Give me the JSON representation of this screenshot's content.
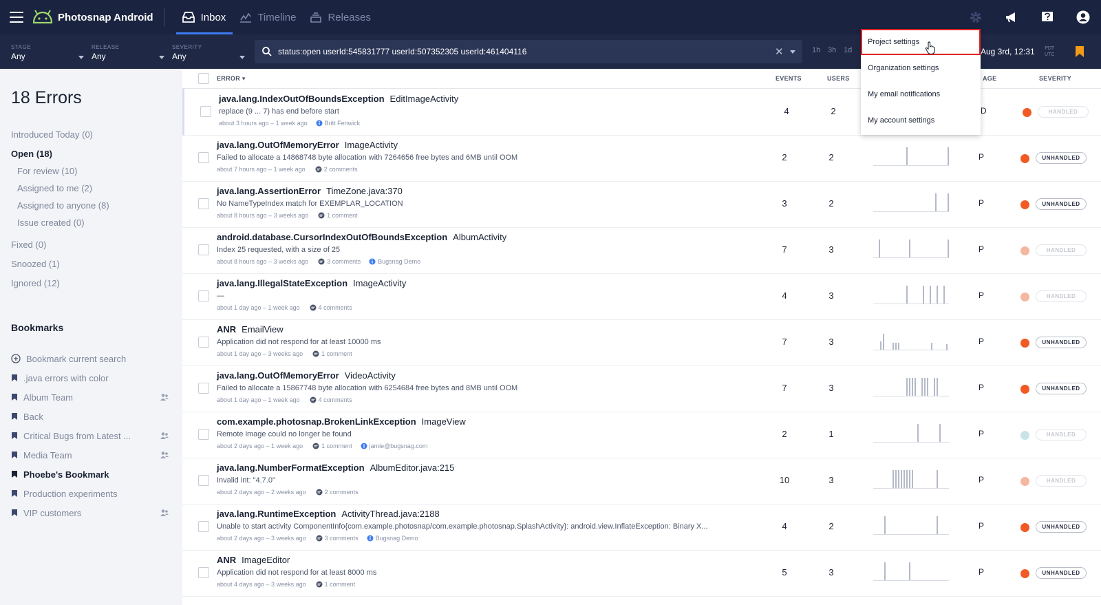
{
  "app": {
    "name": "Photosnap Android"
  },
  "nav": {
    "tabs": [
      {
        "label": "Inbox",
        "active": true
      },
      {
        "label": "Timeline",
        "active": false
      },
      {
        "label": "Releases",
        "active": false
      }
    ]
  },
  "filters": {
    "stage": {
      "label": "STAGE",
      "value": "Any"
    },
    "release": {
      "label": "RELEASE",
      "value": "Any"
    },
    "severity": {
      "label": "SEVERITY",
      "value": "Any"
    }
  },
  "search": {
    "query": "status:open userId:545831777 userId:507352305 userId:461404116"
  },
  "time_ranges": [
    "1h",
    "3h",
    "1d"
  ],
  "date_range": "Aug 3rd, 12:31",
  "timezone": [
    "PDT",
    "UTC"
  ],
  "dropdown": {
    "items": [
      "Project settings",
      "Organization settings",
      "My email notifications",
      "My account settings"
    ]
  },
  "sidebar": {
    "count_title": "18 Errors",
    "filters": [
      {
        "label": "Introduced Today (0)",
        "strong": false,
        "indent": false
      },
      {
        "label": "Open (18)",
        "strong": true,
        "indent": false
      },
      {
        "label": "For review (10)",
        "strong": false,
        "indent": true
      },
      {
        "label": "Assigned to me (2)",
        "strong": false,
        "indent": true
      },
      {
        "label": "Assigned to anyone (8)",
        "strong": false,
        "indent": true
      },
      {
        "label": "Issue created (0)",
        "strong": false,
        "indent": true
      },
      {
        "label": "Fixed (0)",
        "strong": false,
        "indent": false
      },
      {
        "label": "Snoozed (1)",
        "strong": false,
        "indent": false
      },
      {
        "label": "Ignored (12)",
        "strong": false,
        "indent": false
      }
    ],
    "bookmarks_title": "Bookmarks",
    "bookmark_current": "Bookmark current search",
    "bookmarks": [
      {
        "label": ".java errors with color",
        "team": false,
        "active": false
      },
      {
        "label": "Album Team",
        "team": true,
        "active": false
      },
      {
        "label": "Back",
        "team": false,
        "active": false
      },
      {
        "label": "Critical Bugs from Latest ...",
        "team": true,
        "active": false
      },
      {
        "label": "Media Team",
        "team": true,
        "active": false
      },
      {
        "label": "Phoebe's Bookmark",
        "team": false,
        "active": true
      },
      {
        "label": "Production experiments",
        "team": false,
        "active": false
      },
      {
        "label": "VIP customers",
        "team": true,
        "active": false
      }
    ]
  },
  "table": {
    "headers": {
      "error": "ERROR",
      "events": "EVENTS",
      "users": "USERS",
      "stage": "AGE",
      "severity": "SEVERITY"
    },
    "rows": [
      {
        "cls": "java.lang.IndexOutOfBoundsException",
        "ctx": "EditImageActivity",
        "msg": "replace (9 ... 7) has end before start",
        "meta": "about 3 hours ago – 1 week ago",
        "comments": "",
        "user": "Britt Fenwick",
        "events": "4",
        "users": "2",
        "stage": "D",
        "sev_color": "#f15a24",
        "sev_label": "HANDLED",
        "faded": true,
        "spark": [],
        "spark_hidden": true
      },
      {
        "cls": "java.lang.OutOfMemoryError",
        "ctx": "ImageActivity",
        "msg": "Failed to allocate a 14868748 byte allocation with 7264656 free bytes and 6MB until OOM",
        "meta": "about 7 hours ago – 1 week ago",
        "comments": "2 comments",
        "user": "",
        "events": "2",
        "users": "2",
        "stage": "P",
        "sev_color": "#f15a24",
        "sev_label": "UNHANDLED",
        "faded": false,
        "spark": [
          0,
          0,
          0,
          0,
          0,
          0,
          0,
          0,
          0,
          0,
          0,
          0,
          0,
          0,
          0,
          0,
          0,
          0,
          0,
          0,
          0,
          0,
          0,
          0,
          1,
          0,
          0,
          0,
          0,
          0,
          0,
          0,
          0,
          0,
          0,
          0,
          0,
          0,
          0,
          0,
          0,
          0,
          0,
          0,
          0,
          0,
          0,
          0,
          0,
          0,
          0,
          0,
          0,
          0,
          1
        ]
      },
      {
        "cls": "java.lang.AssertionError",
        "ctx": "TimeZone.java:370",
        "msg": "No NameTypeIndex match for EXEMPLAR_LOCATION",
        "meta": "about 8 hours ago – 3 weeks ago",
        "comments": "1 comment",
        "user": "",
        "events": "3",
        "users": "2",
        "stage": "P",
        "sev_color": "#f15a24",
        "sev_label": "UNHANDLED",
        "faded": false,
        "spark": [
          0,
          0,
          0,
          0,
          0,
          0,
          0,
          0,
          0,
          0,
          0,
          0,
          0,
          0,
          0,
          0,
          0,
          0,
          0,
          0,
          0,
          0,
          0,
          0,
          0,
          0,
          0,
          0,
          0,
          0,
          0,
          0,
          0,
          0,
          0,
          0,
          0,
          0,
          0,
          0,
          0,
          0,
          0,
          0,
          0,
          1,
          0,
          0,
          0,
          0,
          0,
          0,
          0,
          0,
          1
        ]
      },
      {
        "cls": "android.database.CursorIndexOutOfBoundsException",
        "ctx": "AlbumActivity",
        "msg": "Index 25 requested, with a size of 25",
        "meta": "about 8 hours ago – 3 weeks ago",
        "comments": "3 comments",
        "user": "Bugsnag Demo",
        "events": "7",
        "users": "3",
        "stage": "P",
        "sev_color": "#f5b7a0",
        "sev_label": "HANDLED",
        "faded": true,
        "spark": [
          0,
          0,
          0,
          0,
          1,
          0,
          0,
          0,
          0,
          0,
          0,
          0,
          0,
          0,
          0,
          0,
          0,
          0,
          0,
          0,
          0,
          0,
          0,
          0,
          0,
          0,
          1,
          0,
          0,
          0,
          0,
          0,
          0,
          0,
          0,
          0,
          0,
          0,
          0,
          0,
          0,
          0,
          0,
          0,
          0,
          0,
          0,
          0,
          0,
          0,
          0,
          0,
          0,
          0,
          1
        ]
      },
      {
        "cls": "java.lang.IllegalStateException",
        "ctx": "ImageActivity",
        "msg": "—",
        "meta": "about 1 day ago – 1 week ago",
        "comments": "4 comments",
        "user": "",
        "events": "4",
        "users": "3",
        "stage": "P",
        "sev_color": "#f5b7a0",
        "sev_label": "HANDLED",
        "faded": true,
        "spark": [
          0,
          0,
          0,
          0,
          0,
          0,
          0,
          0,
          0,
          0,
          0,
          0,
          0,
          0,
          0,
          0,
          0,
          0,
          0,
          0,
          0,
          0,
          0,
          0,
          1,
          0,
          0,
          0,
          0,
          0,
          0,
          0,
          0,
          0,
          0,
          0,
          1,
          0,
          0,
          0,
          0,
          1,
          0,
          0,
          0,
          0,
          1,
          0,
          0,
          0,
          0,
          1,
          0,
          0,
          0
        ]
      },
      {
        "cls": "ANR",
        "ctx": "EmailView",
        "msg": "Application did not respond for at least 10000 ms",
        "meta": "about 1 day ago – 3 weeks ago",
        "comments": "1 comment",
        "user": "",
        "events": "7",
        "users": "3",
        "stage": "P",
        "sev_color": "#f15a24",
        "sev_label": "UNHANDLED",
        "faded": false,
        "spark": [
          0,
          0,
          0,
          0,
          0,
          0.45,
          0,
          0.9,
          0,
          0,
          0,
          0,
          0,
          0,
          0.4,
          0,
          0.4,
          0,
          0.4,
          0,
          0,
          0,
          0,
          0,
          0,
          0,
          0,
          0,
          0,
          0,
          0,
          0,
          0,
          0,
          0,
          0,
          0,
          0,
          0,
          0,
          0,
          0,
          0.4,
          0,
          0,
          0,
          0,
          0,
          0,
          0,
          0,
          0,
          0,
          0.3,
          0
        ]
      },
      {
        "cls": "java.lang.OutOfMemoryError",
        "ctx": "VideoActivity",
        "msg": "Failed to allocate a 15867748 byte allocation with 6254684 free bytes and 8MB until OOM",
        "meta": "about 1 day ago – 1 week ago",
        "comments": "4 comments",
        "user": "",
        "events": "7",
        "users": "3",
        "stage": "P",
        "sev_color": "#f15a24",
        "sev_label": "UNHANDLED",
        "faded": false,
        "spark": [
          0,
          0,
          0,
          0,
          0,
          0,
          0,
          0,
          0,
          0,
          0,
          0,
          0,
          0,
          0,
          0,
          0,
          0,
          0,
          0,
          0,
          0,
          0,
          0,
          1,
          0,
          1,
          0,
          1,
          0,
          1,
          0,
          0,
          0,
          0,
          1,
          0,
          1,
          0,
          1,
          0,
          0,
          0,
          0,
          1,
          0,
          1,
          0,
          0,
          0,
          0,
          0,
          0,
          0,
          0
        ]
      },
      {
        "cls": "com.example.photosnap.BrokenLinkException",
        "ctx": "ImageView",
        "msg": "Remote image could no longer be found",
        "meta": "about 2 days ago – 1 week ago",
        "comments": "1 comment",
        "user": "jamie@bugsnag.com",
        "events": "2",
        "users": "1",
        "stage": "P",
        "sev_color": "#c9e3e8",
        "sev_label": "HANDLED",
        "faded": true,
        "spark": [
          0,
          0,
          0,
          0,
          0,
          0,
          0,
          0,
          0,
          0,
          0,
          0,
          0,
          0,
          0,
          0,
          0,
          0,
          0,
          0,
          0,
          0,
          0,
          0,
          0,
          0,
          0,
          0,
          0,
          0,
          0,
          0,
          1,
          0,
          0,
          0,
          0,
          0,
          0,
          0,
          0,
          0,
          0,
          0,
          0,
          0,
          0,
          0,
          1,
          0,
          0,
          0,
          0,
          0,
          0
        ]
      },
      {
        "cls": "java.lang.NumberFormatException",
        "ctx": "AlbumEditor.java:215",
        "msg": "Invalid int: \"4.7.0\"",
        "meta": "about 2 days ago – 2 weeks ago",
        "comments": "2 comments",
        "user": "",
        "events": "10",
        "users": "3",
        "stage": "P",
        "sev_color": "#f5b7a0",
        "sev_label": "HANDLED",
        "faded": true,
        "spark": [
          0,
          0,
          0,
          0,
          0,
          0,
          0,
          0,
          0,
          0,
          0,
          0,
          0,
          0,
          1,
          0,
          1,
          0,
          1,
          0,
          1,
          0,
          1,
          0,
          1,
          0,
          1,
          0,
          1,
          0,
          0,
          0,
          0,
          0,
          0,
          0,
          0,
          0,
          0,
          0,
          0,
          0,
          0,
          0,
          0,
          0,
          1,
          0,
          0,
          0,
          0,
          0,
          0,
          0,
          0
        ]
      },
      {
        "cls": "java.lang.RuntimeException",
        "ctx": "ActivityThread.java:2188",
        "msg": "Unable to start activity ComponentInfo{com.example.photosnap/com.example.photosnap.SplashActivity}: android.view.InflateException: Binary X...",
        "meta": "about 2 days ago – 3 weeks ago",
        "comments": "3 comments",
        "user": "Bugsnag Demo",
        "events": "4",
        "users": "2",
        "stage": "P",
        "sev_color": "#f15a24",
        "sev_label": "UNHANDLED",
        "faded": false,
        "spark": [
          0,
          0,
          0,
          0,
          0,
          0,
          0,
          0,
          1,
          0,
          0,
          0,
          0,
          0,
          0,
          0,
          0,
          0,
          0,
          0,
          0,
          0,
          0,
          0,
          0,
          0,
          0,
          0,
          0,
          0,
          0,
          0,
          0,
          0,
          0,
          0,
          0,
          0,
          0,
          0,
          0,
          0,
          0,
          0,
          0,
          0,
          1,
          0,
          0,
          0,
          0,
          0,
          0,
          0,
          0
        ]
      },
      {
        "cls": "ANR",
        "ctx": "ImageEditor",
        "msg": "Application did not respond for at least 8000 ms",
        "meta": "about 4 days ago – 3 weeks ago",
        "comments": "1 comment",
        "user": "",
        "events": "5",
        "users": "3",
        "stage": "P",
        "sev_color": "#f15a24",
        "sev_label": "UNHANDLED",
        "faded": false,
        "spark": [
          0,
          0,
          0,
          0,
          0,
          0,
          0,
          0,
          1,
          0,
          0,
          0,
          0,
          0,
          0,
          0,
          0,
          0,
          0,
          0,
          0,
          0,
          0,
          0,
          0,
          0,
          1,
          0,
          0,
          0,
          0,
          0,
          0,
          0,
          0,
          0,
          0,
          0,
          0,
          0,
          0,
          0,
          0,
          0,
          0,
          0,
          0,
          0,
          0,
          0,
          0,
          0,
          0,
          0,
          0
        ]
      }
    ]
  },
  "colors": {
    "nav_bg": "#1a2340",
    "filter_bg": "#1f2945",
    "accent": "#3f7cf2",
    "unhandled": "#f15a24",
    "highlight_box": "#e02424",
    "bookmark_flag": "#f29a1a"
  }
}
